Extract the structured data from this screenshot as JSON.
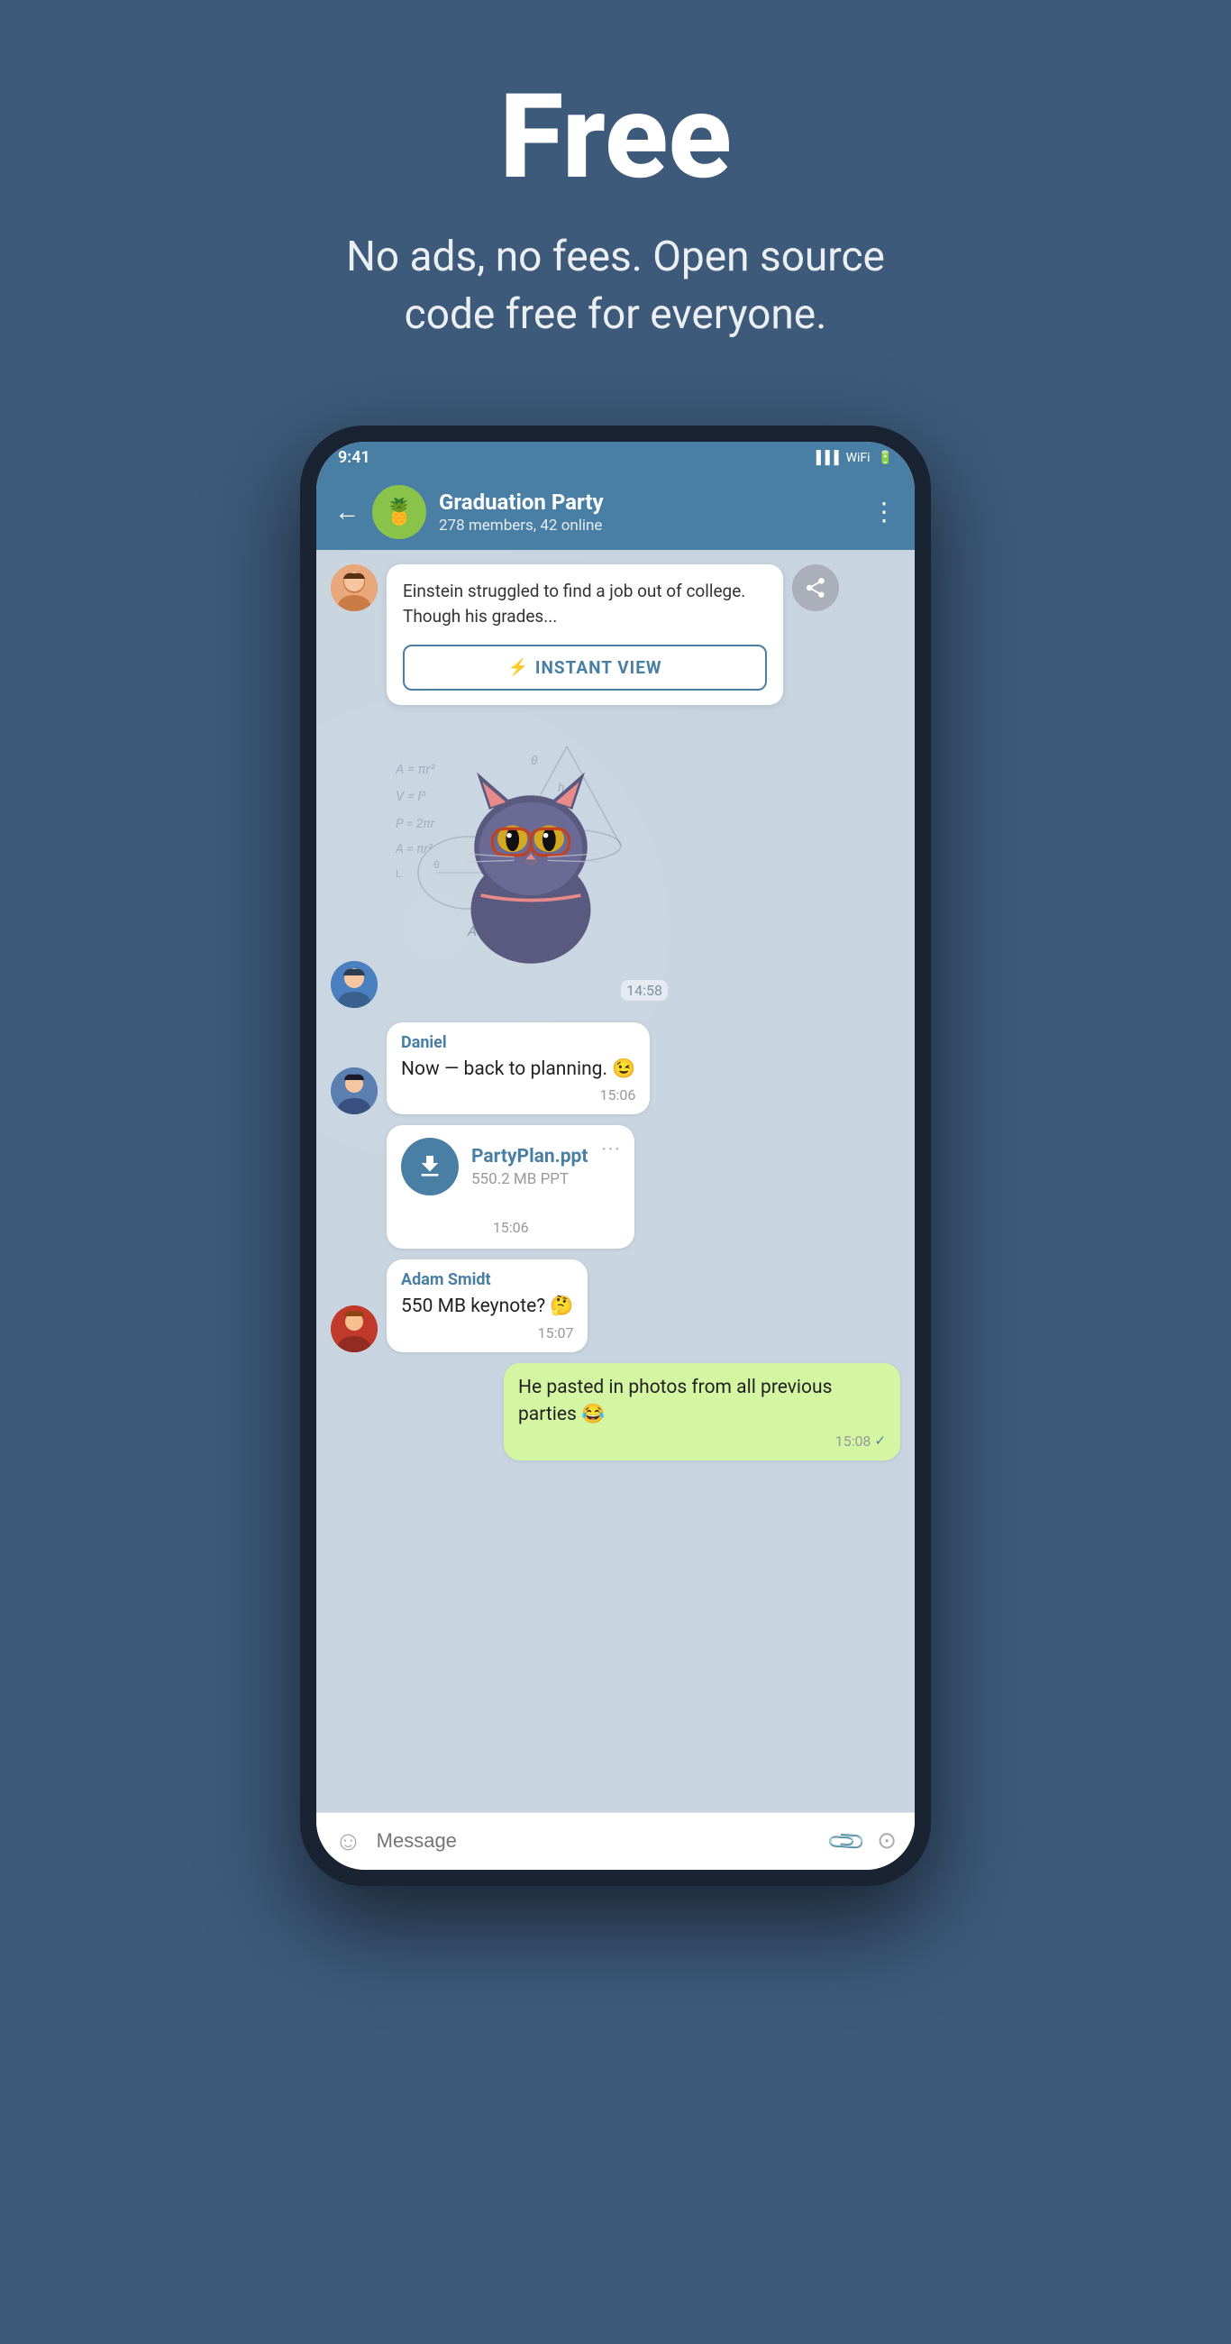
{
  "hero": {
    "title": "Free",
    "subtitle": "No ads, no fees. Open source code free for everyone."
  },
  "phone": {
    "chat": {
      "name": "Graduation Party",
      "status": "278 members, 42 online"
    },
    "messages": [
      {
        "type": "instant_view",
        "text": "Einstein struggled to find a job out of college. Though his grades...",
        "button": "INSTANT VIEW"
      },
      {
        "type": "sticker",
        "time": "14:58"
      },
      {
        "type": "text",
        "sender": "Daniel",
        "text": "Now — back to planning. 😉",
        "time": "15:06"
      },
      {
        "type": "file",
        "filename": "PartyPlan.ppt",
        "filesize": "550.2 MB PPT",
        "time": "15:06"
      },
      {
        "type": "text",
        "sender": "Adam Smidt",
        "text": "550 MB keynote? 🤔",
        "time": "15:07"
      },
      {
        "type": "sent",
        "text": "He pasted in photos from all previous parties 😂",
        "time": "15:08",
        "check": "✓"
      }
    ],
    "input": {
      "placeholder": "Message"
    }
  }
}
